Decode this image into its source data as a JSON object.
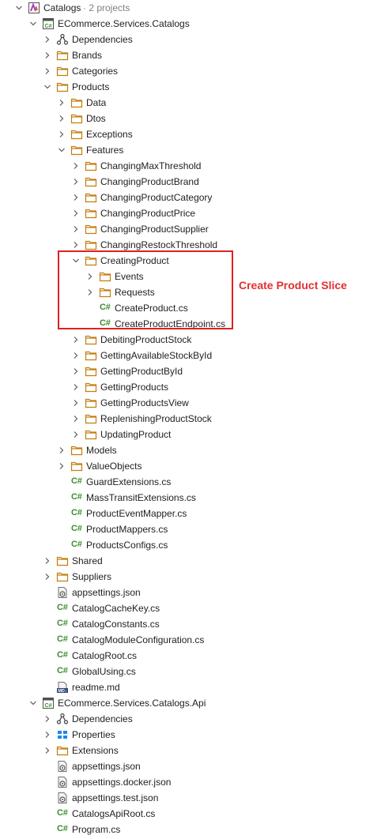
{
  "solution": {
    "label": "Catalogs",
    "sub": "· 2 projects"
  },
  "annotation": "Create Product Slice",
  "rows": [
    {
      "d": 0,
      "chev": "down",
      "icon": "solution",
      "label": "Catalogs",
      "sub": "· 2 projects"
    },
    {
      "d": 1,
      "chev": "down",
      "icon": "csproj",
      "label": "ECommerce.Services.Catalogs"
    },
    {
      "d": 2,
      "chev": "right",
      "icon": "deps",
      "label": "Dependencies"
    },
    {
      "d": 2,
      "chev": "right",
      "icon": "folder",
      "label": "Brands"
    },
    {
      "d": 2,
      "chev": "right",
      "icon": "folder",
      "label": "Categories"
    },
    {
      "d": 2,
      "chev": "down",
      "icon": "folder",
      "label": "Products"
    },
    {
      "d": 3,
      "chev": "right",
      "icon": "folder",
      "label": "Data"
    },
    {
      "d": 3,
      "chev": "right",
      "icon": "folder",
      "label": "Dtos"
    },
    {
      "d": 3,
      "chev": "right",
      "icon": "folder",
      "label": "Exceptions"
    },
    {
      "d": 3,
      "chev": "down",
      "icon": "folder",
      "label": "Features"
    },
    {
      "d": 4,
      "chev": "right",
      "icon": "folder",
      "label": "ChangingMaxThreshold"
    },
    {
      "d": 4,
      "chev": "right",
      "icon": "folder",
      "label": "ChangingProductBrand"
    },
    {
      "d": 4,
      "chev": "right",
      "icon": "folder",
      "label": "ChangingProductCategory"
    },
    {
      "d": 4,
      "chev": "right",
      "icon": "folder",
      "label": "ChangingProductPrice"
    },
    {
      "d": 4,
      "chev": "right",
      "icon": "folder",
      "label": "ChangingProductSupplier"
    },
    {
      "d": 4,
      "chev": "right",
      "icon": "folder",
      "label": "ChangingRestockThreshold"
    },
    {
      "d": 4,
      "chev": "down",
      "icon": "folder",
      "label": "CreatingProduct"
    },
    {
      "d": 5,
      "chev": "right",
      "icon": "folder",
      "label": "Events"
    },
    {
      "d": 5,
      "chev": "right",
      "icon": "folder",
      "label": "Requests"
    },
    {
      "d": 5,
      "chev": "none",
      "icon": "cs",
      "label": "CreateProduct.cs"
    },
    {
      "d": 5,
      "chev": "none",
      "icon": "cs",
      "label": "CreateProductEndpoint.cs"
    },
    {
      "d": 4,
      "chev": "right",
      "icon": "folder",
      "label": "DebitingProductStock"
    },
    {
      "d": 4,
      "chev": "right",
      "icon": "folder",
      "label": "GettingAvailableStockById"
    },
    {
      "d": 4,
      "chev": "right",
      "icon": "folder",
      "label": "GettingProductById"
    },
    {
      "d": 4,
      "chev": "right",
      "icon": "folder",
      "label": "GettingProducts"
    },
    {
      "d": 4,
      "chev": "right",
      "icon": "folder",
      "label": "GettingProductsView"
    },
    {
      "d": 4,
      "chev": "right",
      "icon": "folder",
      "label": "ReplenishingProductStock"
    },
    {
      "d": 4,
      "chev": "right",
      "icon": "folder",
      "label": "UpdatingProduct"
    },
    {
      "d": 3,
      "chev": "right",
      "icon": "folder",
      "label": "Models"
    },
    {
      "d": 3,
      "chev": "right",
      "icon": "folder",
      "label": "ValueObjects"
    },
    {
      "d": 3,
      "chev": "none",
      "icon": "cs",
      "label": "GuardExtensions.cs"
    },
    {
      "d": 3,
      "chev": "none",
      "icon": "cs",
      "label": "MassTransitExtensions.cs"
    },
    {
      "d": 3,
      "chev": "none",
      "icon": "cs",
      "label": "ProductEventMapper.cs"
    },
    {
      "d": 3,
      "chev": "none",
      "icon": "cs",
      "label": "ProductMappers.cs"
    },
    {
      "d": 3,
      "chev": "none",
      "icon": "cs",
      "label": "ProductsConfigs.cs"
    },
    {
      "d": 2,
      "chev": "right",
      "icon": "folder",
      "label": "Shared"
    },
    {
      "d": 2,
      "chev": "right",
      "icon": "folder",
      "label": "Suppliers"
    },
    {
      "d": 2,
      "chev": "none",
      "icon": "json",
      "label": "appsettings.json"
    },
    {
      "d": 2,
      "chev": "none",
      "icon": "cs",
      "label": "CatalogCacheKey.cs"
    },
    {
      "d": 2,
      "chev": "none",
      "icon": "cs",
      "label": "CatalogConstants.cs"
    },
    {
      "d": 2,
      "chev": "none",
      "icon": "cs",
      "label": "CatalogModuleConfiguration.cs"
    },
    {
      "d": 2,
      "chev": "none",
      "icon": "cs",
      "label": "CatalogRoot.cs"
    },
    {
      "d": 2,
      "chev": "none",
      "icon": "cs",
      "label": "GlobalUsing.cs"
    },
    {
      "d": 2,
      "chev": "none",
      "icon": "md",
      "label": "readme.md"
    },
    {
      "d": 1,
      "chev": "down",
      "icon": "csproj",
      "label": "ECommerce.Services.Catalogs.Api"
    },
    {
      "d": 2,
      "chev": "right",
      "icon": "deps",
      "label": "Dependencies"
    },
    {
      "d": 2,
      "chev": "right",
      "icon": "props",
      "label": "Properties"
    },
    {
      "d": 2,
      "chev": "right",
      "icon": "folder",
      "label": "Extensions"
    },
    {
      "d": 2,
      "chev": "none",
      "icon": "json",
      "label": "appsettings.json"
    },
    {
      "d": 2,
      "chev": "none",
      "icon": "json",
      "label": "appsettings.docker.json"
    },
    {
      "d": 2,
      "chev": "none",
      "icon": "json",
      "label": "appsettings.test.json"
    },
    {
      "d": 2,
      "chev": "none",
      "icon": "cs",
      "label": "CatalogsApiRoot.cs"
    },
    {
      "d": 2,
      "chev": "none",
      "icon": "cs",
      "label": "Program.cs"
    }
  ]
}
